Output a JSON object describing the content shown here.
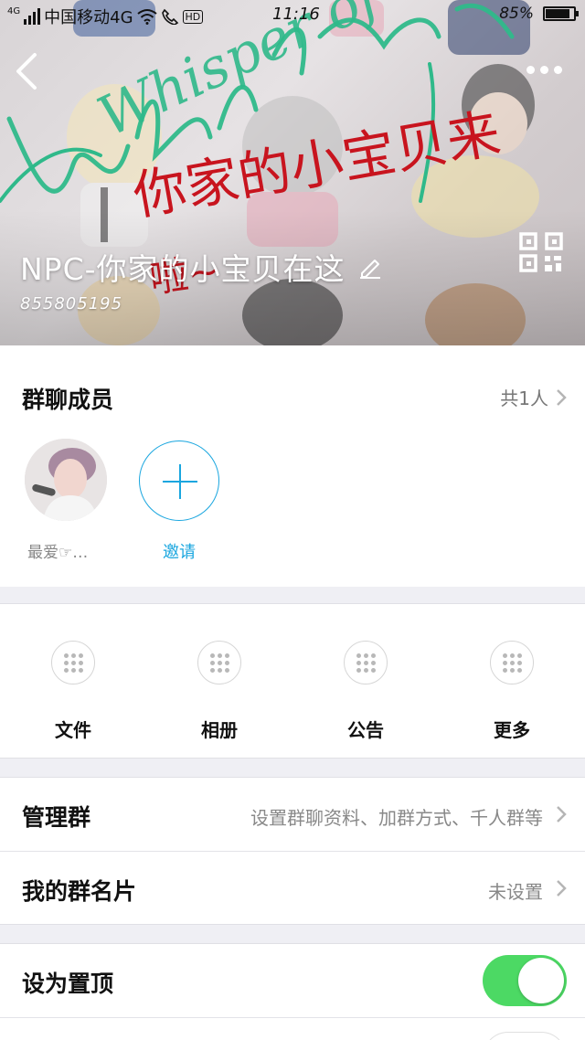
{
  "status_bar": {
    "network_small": "4G",
    "carrier": "中国移动4G",
    "hd": "HD",
    "time": "11:16",
    "battery_percent": "85%",
    "battery_level": 0.85
  },
  "header": {
    "group_name": "NPC-你家的小宝贝在这",
    "group_id": "855805195",
    "banner_text_1": "你家的小宝贝来",
    "banner_text_2": "啦~",
    "banner_text_3": "Whisper of"
  },
  "members": {
    "title": "群聊成员",
    "count": "共1人",
    "list": [
      {
        "name": "最爱☞…"
      }
    ],
    "invite_label": "邀请"
  },
  "features": [
    {
      "label": "文件"
    },
    {
      "label": "相册"
    },
    {
      "label": "公告"
    },
    {
      "label": "更多"
    }
  ],
  "list": {
    "manage": {
      "label": "管理群",
      "value": "设置群聊资料、加群方式、千人群等"
    },
    "card": {
      "label": "我的群名片",
      "value": "未设置"
    }
  },
  "pin": {
    "label": "设为置顶",
    "enabled": true
  },
  "colors": {
    "accent_blue": "#19a6df",
    "toggle_green": "#4cd964",
    "script_green": "#2fb98a",
    "script_red": "#c8141e"
  }
}
